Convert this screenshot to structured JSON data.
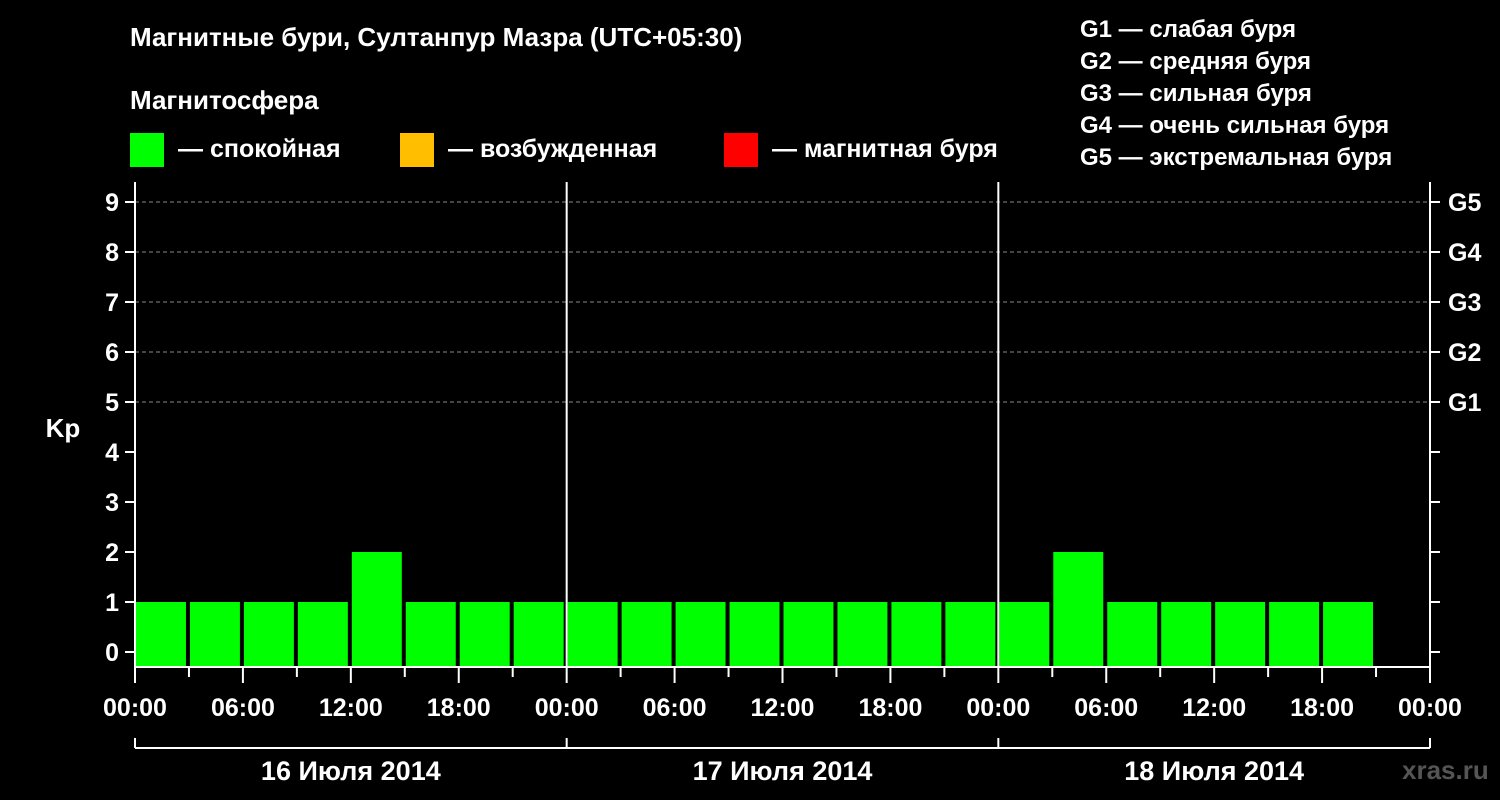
{
  "title": "Магнитные бури, Султанпур Мазра (UTC+05:30)",
  "section_label": "Магнитосфера",
  "legend": [
    {
      "label": "— спокойная",
      "color": "#00ff00"
    },
    {
      "label": "— возбужденная",
      "color": "#ffbf00"
    },
    {
      "label": "— магнитная буря",
      "color": "#ff0000"
    }
  ],
  "g_scale": [
    "G1 — слабая буря",
    "G2 — средняя буря",
    "G3 — сильная буря",
    "G4 — очень сильная буря",
    "G5 — экстремальная буря"
  ],
  "watermark": "xras.ru",
  "chart_data": {
    "type": "bar",
    "ylabel": "Kp",
    "ylim": [
      0,
      9
    ],
    "yticks": [
      "0",
      "1",
      "2",
      "3",
      "4",
      "5",
      "6",
      "7",
      "8",
      "9"
    ],
    "right_axis_labels": [
      {
        "kp": 5,
        "label": "G1"
      },
      {
        "kp": 6,
        "label": "G2"
      },
      {
        "kp": 7,
        "label": "G3"
      },
      {
        "kp": 8,
        "label": "G4"
      },
      {
        "kp": 9,
        "label": "G5"
      }
    ],
    "x_tick_labels": [
      "00:00",
      "06:00",
      "12:00",
      "18:00",
      "00:00",
      "06:00",
      "12:00",
      "18:00",
      "00:00",
      "06:00",
      "12:00",
      "18:00",
      "00:00"
    ],
    "days": [
      "16 Июля 2014",
      "17 Июля 2014",
      "18 Июля 2014"
    ],
    "interval_hours": 3,
    "grid": "dashed horizontal at Kp 5-9",
    "values": [
      1,
      1,
      1,
      1,
      2,
      1,
      1,
      1,
      1,
      1,
      1,
      1,
      1,
      1,
      1,
      1,
      1,
      2,
      1,
      1,
      1,
      1,
      1
    ],
    "colors": [
      "#00ff00",
      "#00ff00",
      "#00ff00",
      "#00ff00",
      "#00ff00",
      "#00ff00",
      "#00ff00",
      "#00ff00",
      "#00ff00",
      "#00ff00",
      "#00ff00",
      "#00ff00",
      "#00ff00",
      "#00ff00",
      "#00ff00",
      "#00ff00",
      "#00ff00",
      "#00ff00",
      "#00ff00",
      "#00ff00",
      "#00ff00",
      "#00ff00",
      "#00ff00"
    ]
  }
}
